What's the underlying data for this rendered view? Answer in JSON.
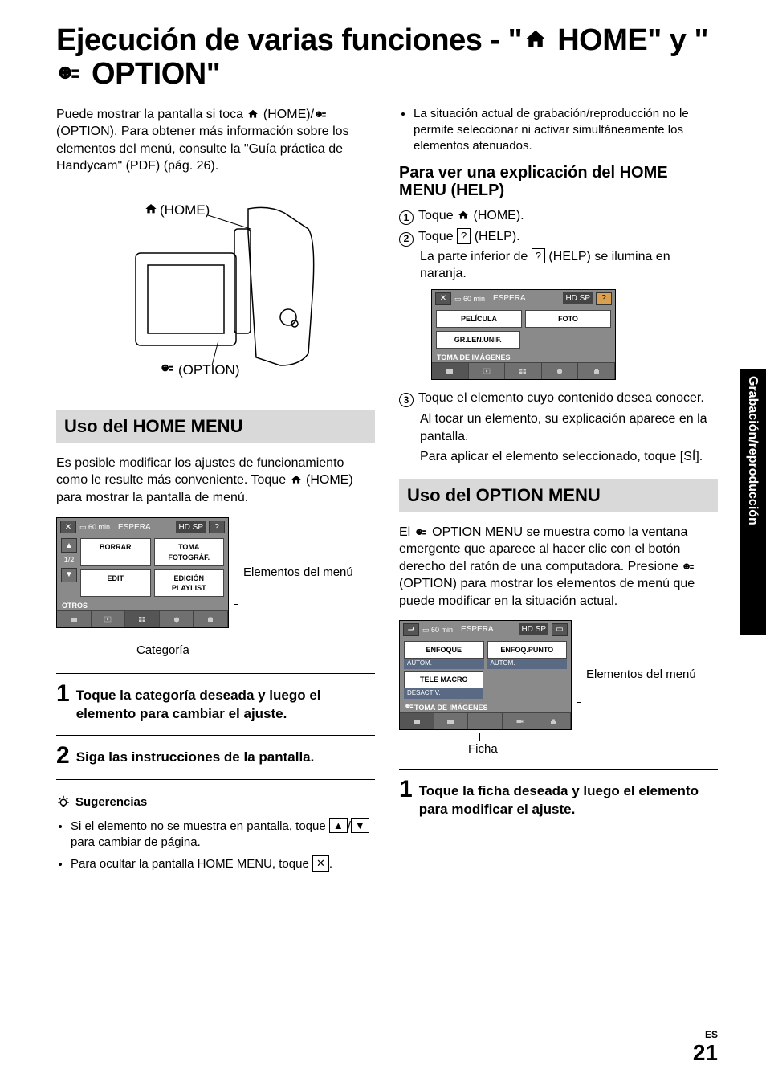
{
  "title_pre": "Ejecución de varias funciones - \"",
  "title_home": " HOME\" y \"",
  "title_option": " OPTION\"",
  "intro": "Puede mostrar la pantalla si toca ",
  "intro_home": " (HOME)/",
  "intro_option": " (OPTION). Para obtener más información sobre los elementos del menú, consulte la \"Guía práctica de Handycam\" (PDF) (pág. 26).",
  "diagram": {
    "home": " (HOME)",
    "option": " (OPTION)"
  },
  "home_section": {
    "bar": "Uso del HOME MENU",
    "para": "Es posible modificar los ajustes de funcionamiento como le resulte más conveniente. Toque ",
    "para2": " (HOME) para mostrar la pantalla de menú.",
    "ss": {
      "batt": "60 min",
      "wait": "ESPERA",
      "hd": "HD SP",
      "b1": "BORRAR",
      "b2": "TOMA FOTOGRÁF.",
      "b3": "EDIT",
      "b4": "EDICIÓN PLAYLIST",
      "page": "1/2",
      "otros": "OTROS"
    },
    "ann_items": "Elementos del menú",
    "ann_cat": "Categoría",
    "step1": "Toque la categoría deseada y luego el elemento para cambiar el ajuste.",
    "step2": "Siga las instrucciones de la pantalla."
  },
  "tips": {
    "head": "Sugerencias",
    "t1a": "Si el elemento no se muestra en pantalla, toque ",
    "t1b": " para cambiar de página.",
    "t2": "Para ocultar la pantalla HOME MENU, toque ",
    "t2b": "."
  },
  "right": {
    "bullet": "La situación actual de grabación/reproducción no le permite seleccionar ni activar simultáneamente los elementos atenuados.",
    "help_h": "Para ver una explicación del HOME MENU (HELP)",
    "s1": "Toque ",
    "s1b": " (HOME).",
    "s2": "Toque ",
    "s2b": " (HELP).",
    "s2c": "La parte inferior de ",
    "s2d": " (HELP) se ilumina en naranja.",
    "help_ss": {
      "batt": "60 min",
      "wait": "ESPERA",
      "hd": "HD SP",
      "b1": "PELÍCULA",
      "b2": "FOTO",
      "b3": "GR.LEN.UNIF.",
      "label": "TOMA DE IMÁGENES"
    },
    "s3a": "Toque el elemento cuyo contenido desea conocer.",
    "s3b": "Al tocar un elemento, su explicación aparece en la pantalla.",
    "s3c": "Para aplicar el elemento seleccionado, toque [SÍ].",
    "opt_bar": "Uso del OPTION MENU",
    "opt_para1": "El ",
    "opt_para2": " OPTION MENU se muestra como la ventana emergente que aparece al hacer clic con el botón derecho del ratón de una computadora. Presione ",
    "opt_para3": " (OPTION) para mostrar los elementos de menú que puede modificar en la situación actual.",
    "opt_ss": {
      "batt": "60 min",
      "wait": "ESPERA",
      "hd": "HD SP",
      "b1": "ENFOQUE",
      "b1s": "AUTOM.",
      "b2": "ENFOQ.PUNTO",
      "b2s": "AUTOM.",
      "b3": "TELE MACRO",
      "b3s": "DESACTIV.",
      "label": "TOMA DE IMÁGENES"
    },
    "ann_items": "Elementos del menú",
    "ann_ficha": "Ficha",
    "step1": "Toque la ficha deseada y luego el elemento para modificar el ajuste."
  },
  "sidebar": "Grabación/reproducción",
  "footer": {
    "es": "ES",
    "page": "21"
  }
}
